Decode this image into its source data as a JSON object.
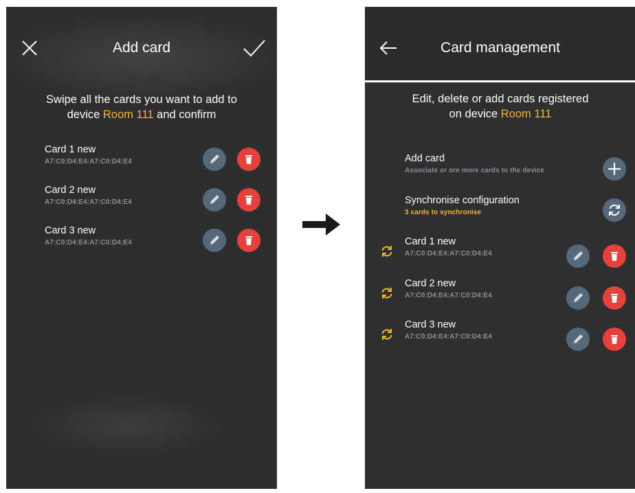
{
  "left_screen": {
    "title": "Add card",
    "desc_line1": "Swipe all the cards you want to add to",
    "desc_line2_pre": "device ",
    "device_name": "Room 111",
    "desc_line2_post": " and confirm",
    "cards": [
      {
        "name": "Card 1 new",
        "id": "A7:C0:D4:E4:A7:C0:D4:E4"
      },
      {
        "name": "Card 2 new",
        "id": "A7:C0:D4:E4:A7:C0:D4:E4"
      },
      {
        "name": "Card 3 new",
        "id": "A7:C0:D4:E4:A7:C0:D4:E4"
      }
    ]
  },
  "right_screen": {
    "title": "Card management",
    "desc_line1": "Edit, delete or add cards registered",
    "desc_line2_pre": "on device ",
    "device_name": "Room 111",
    "add_card": {
      "title": "Add card",
      "subtitle": "Associate or ore more cards to the device"
    },
    "sync": {
      "title": "Synchronise configuration",
      "subtitle": "3 cards to synchronise"
    },
    "cards": [
      {
        "name": "Card 1 new",
        "id": "A7:C0:D4:E4:A7:C0:D4:E4"
      },
      {
        "name": "Card 2 new",
        "id": "A7:C0:D4:E4:A7:C0:D4:E4"
      },
      {
        "name": "Card 3 new",
        "id": "A7:C0:D4:E4:A7:C0:D4:E4"
      }
    ]
  },
  "colors": {
    "accent": "#f5b523",
    "delete": "#e8403a",
    "edit": "#56697a",
    "background": "#2e2f31"
  },
  "icons": [
    "close-icon",
    "check-icon",
    "back-arrow-icon",
    "pencil-icon",
    "trash-icon",
    "plus-icon",
    "sync-icon",
    "right-arrow-icon"
  ]
}
